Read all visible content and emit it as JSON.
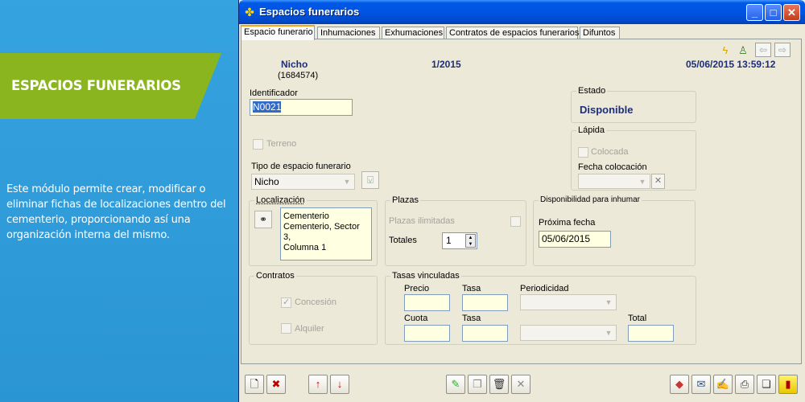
{
  "promo": {
    "title": "ESPACIOS FUNERARIOS",
    "description": "Este módulo permite crear, modificar o eliminar fichas de localizaciones dentro del cementerio, proporcionando así una organización interna del mismo."
  },
  "window": {
    "title": "Espacios funerarios",
    "controls": {
      "minimize": "_",
      "maximize": "□",
      "close": "✕"
    }
  },
  "tabs": [
    "Espacio funerario",
    "Inhumaciones",
    "Exhumaciones",
    "Contratos de espacios funerarios",
    "Difuntos"
  ],
  "header": {
    "type": "Nicho",
    "code": "(1684574)",
    "number": "1/2015",
    "datetime": "05/06/2015 13:59:12"
  },
  "form": {
    "identificador_label": "Identificador",
    "identificador_value": "N0021",
    "terreno_label": "Terreno",
    "tipo_label": "Tipo de espacio funerario",
    "tipo_value": "Nicho",
    "estado_label": "Estado",
    "estado_value": "Disponible",
    "lapida_label": "Lápida",
    "colocada_label": "Colocada",
    "fecha_colocacion_label": "Fecha colocación",
    "localizacion_label": "Localización",
    "localizacion_value": [
      "Cementerio",
      "Cementerio, Sector 3,",
      "Columna 1"
    ],
    "plazas_label": "Plazas",
    "plazas_ilimitadas_label": "Plazas ilimitadas",
    "totales_label": "Totales",
    "totales_value": "1",
    "disponibilidad_label": "Disponibilidad para inhumar",
    "proxima_fecha_label": "Próxima fecha",
    "proxima_fecha_value": "05/06/2015",
    "contratos_label": "Contratos",
    "concesion_label": "Concesión",
    "alquiler_label": "Alquiler",
    "tasas_label": "Tasas vinculadas",
    "precio_label": "Precio",
    "tasa_label": "Tasa",
    "periodicidad_label": "Periodicidad",
    "cuota_label": "Cuota",
    "tasa2_label": "Tasa",
    "total_label": "Total"
  }
}
